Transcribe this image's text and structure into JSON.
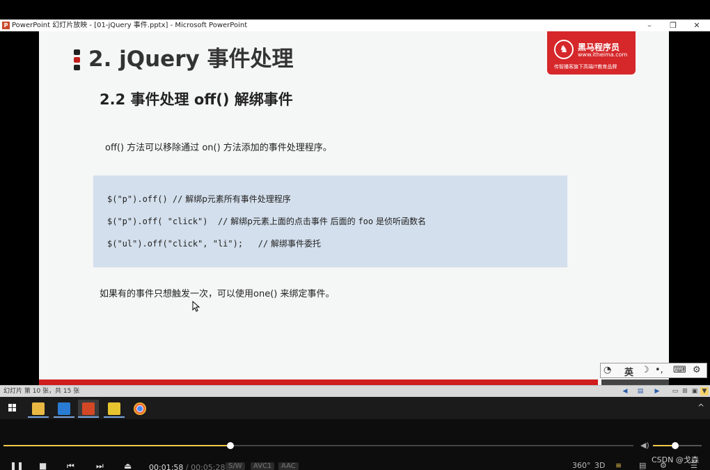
{
  "window": {
    "title": "PowerPoint 幻灯片放映 - [01-jQuery 事件.pptx] - Microsoft PowerPoint",
    "minimize": "–",
    "restore": "❐",
    "close": "✕"
  },
  "slide": {
    "title": "2. jQuery 事件处理",
    "subtitle": "2.2 事件处理 off() 解绑事件",
    "description": "off() 方法可以移除通过 on() 方法添加的事件处理程序。",
    "code": [
      {
        "code": "$(\"p\").off() //",
        "comment": " 解绑p元素所有事件处理程序"
      },
      {
        "code": "$(\"p\").off( \"click\")  //",
        "comment": " 解绑p元素上面的点击事件 后面的 ",
        "code2": "foo",
        "comment2": " 是侦听函数名"
      },
      {
        "code": "$(\"ul\").off(\"click\", \"li\");   //",
        "comment": " 解绑事件委托"
      }
    ],
    "note": "如果有的事件只想触发一次，可以使用one() 来绑定事件。"
  },
  "logo": {
    "brand": "黑马程序员",
    "url": "www.itheima.com",
    "slogan": "传智播客旗下高端IT教育品牌"
  },
  "ime": {
    "lang": "英",
    "moon": "☽",
    "punct": "•,",
    "keyboard": "⌨",
    "settings": "⚙"
  },
  "statusbar": {
    "slide_count": "幻灯片 第 10 张，共 15 张"
  },
  "player": {
    "current_time": "00:01:58",
    "separator": " / ",
    "total_time": "00:05:28",
    "badges": [
      "S/W",
      "AVC1",
      "AAC"
    ],
    "progress": 0.36,
    "volume": 0.45,
    "right_labels": [
      "360°",
      "3D"
    ],
    "watermark": "CSDN @戈森"
  },
  "colors": {
    "accent_red": "#d01c1c",
    "code_bg": "#d3dfec",
    "progress": "#f2c94c"
  }
}
